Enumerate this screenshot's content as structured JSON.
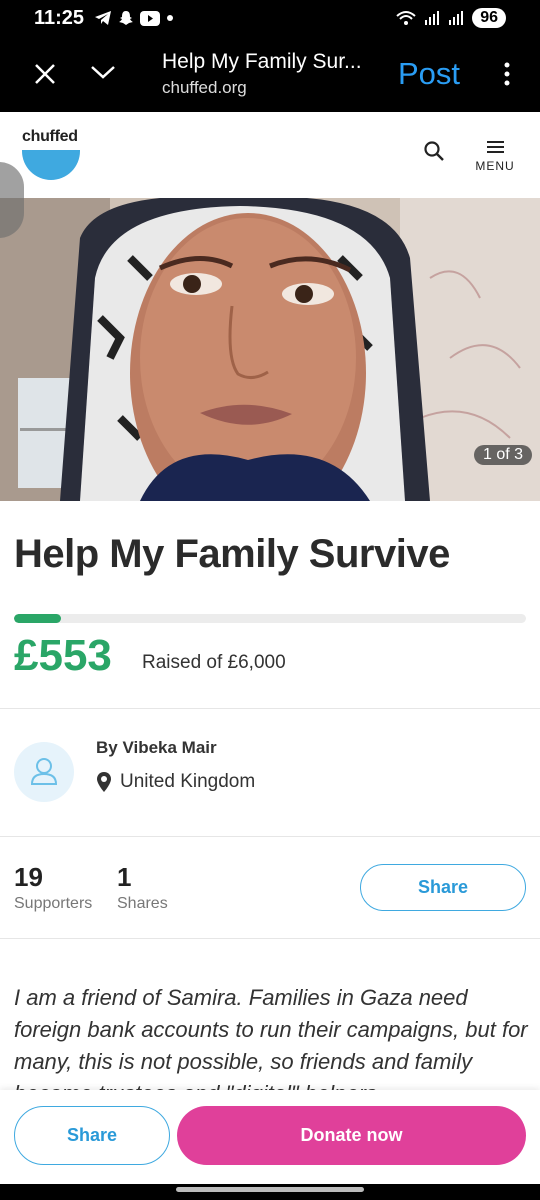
{
  "status": {
    "time": "11:25",
    "notification_icons": [
      "telegram-icon",
      "snapchat-icon",
      "youtube-icon",
      "dot-icon"
    ],
    "signal_icons": [
      "wifi-icon",
      "signal-icon",
      "signal-icon"
    ],
    "battery": "96"
  },
  "browser": {
    "page_title": "Help My Family Sur...",
    "url": "chuffed.org",
    "post_label": "Post"
  },
  "site": {
    "logo_text": "chuffed",
    "menu_label": "MENU"
  },
  "hero": {
    "counter": "1 of 3"
  },
  "campaign": {
    "title": "Help My Family Survive",
    "amount": "£553",
    "raised_text": "Raised of £6,000",
    "progress_fraction": 0.092,
    "accent_color": "#2aa667"
  },
  "organizer": {
    "byline": "By Vibeka Mair",
    "location": "United Kingdom"
  },
  "stats": {
    "supporters_count": "19",
    "supporters_label": "Supporters",
    "shares_count": "1",
    "shares_label": "Shares",
    "share_button": "Share"
  },
  "story": {
    "text": "I am a friend of Samira. Families in Gaza need foreign bank accounts to run their campaigns, but for many, this is not possible, so friends and family become trustees and \"digital\" helpers"
  },
  "actions": {
    "share_label": "Share",
    "donate_label": "Donate now",
    "donate_color": "#e0409a"
  }
}
